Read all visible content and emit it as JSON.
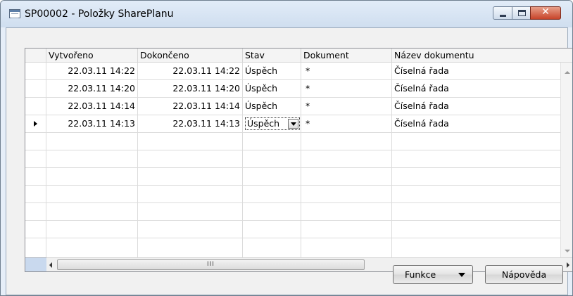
{
  "window": {
    "title": "SP00002 - Položky SharePlanu",
    "icon": "table-window-icon",
    "controls": {
      "minimize": "minimize-icon",
      "maximize": "maximize-icon",
      "close": "✕"
    }
  },
  "table": {
    "columns": [
      "Vytvořeno",
      "Dokončeno",
      "Stav",
      "Dokument",
      "Název dokumentu"
    ],
    "rows": [
      {
        "vytvoreno": "22.03.11 14:22",
        "dokonceno": "22.03.11 14:22",
        "stav": "Úspěch",
        "dokument": "*",
        "nazev": "Číselná řada"
      },
      {
        "vytvoreno": "22.03.11 14:20",
        "dokonceno": "22.03.11 14:20",
        "stav": "Úspěch",
        "dokument": "*",
        "nazev": "Číselná řada"
      },
      {
        "vytvoreno": "22.03.11 14:14",
        "dokonceno": "22.03.11 14:14",
        "stav": "Úspěch",
        "dokument": "*",
        "nazev": "Číselná řada"
      },
      {
        "vytvoreno": "22.03.11 14:13",
        "dokonceno": "22.03.11 14:13",
        "stav": "Úspěch",
        "dokument": "*",
        "nazev": "Číselná řada"
      }
    ],
    "selected_row": 4,
    "empty_rows": 6,
    "scroll_grip": "III"
  },
  "buttons": {
    "funkce": "Funkce",
    "napoveda": "Nápověda"
  }
}
